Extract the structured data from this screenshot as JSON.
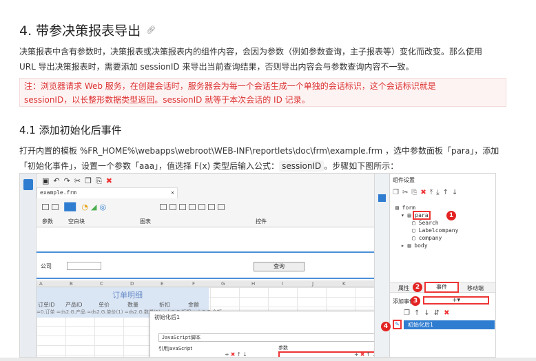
{
  "heading": "4. 带参决策报表导出",
  "heading_anchor_icon": "link-icon",
  "intro_line1": "决策报表中含有参数时，决策报表或决策报表内的组件内容，会因为参数（例如参数查询，主子报表等）变化而改变。那么使用",
  "intro_line2": "URL 导出决策报表时，需要添加 sessionID 来导出当前查询结果，否则导出内容会与参数查询内容不一致。",
  "note_line1": "注：浏览器请求 Web 服务，在创建会话时，服务器会为每一个会话生成一个单独的会话标识，这个会话标识就是",
  "note_line2": "sessionID，以长整形数据类型返回。sessionID 就等于本次会话的 ID 记录。",
  "subheading": "4.1 添加初始化后事件",
  "step": {
    "part1": "打开内置的模板 %FR_HOME%\\webapps\\webroot\\WEB-INF\\reportlets\\doc\\frm\\example.frm ，选中参数面板「para」，添加",
    "part2": "「初始化事件」，设置一个参数「aaa」，值选择 F(x) 类型后输入公式：",
    "code": "sessionID",
    "part3": "。步骤如下图所示："
  },
  "colors": {
    "accent": "#2f7dd1",
    "highlight": "#e33333",
    "note_bg": "#fdf3f3"
  },
  "screenshot": {
    "tab_label": "example.frm",
    "group_labels": [
      "参数",
      "空白块",
      "图表",
      "控件"
    ],
    "param_label": "公司",
    "query_button": "查询",
    "col_letters": [
      "A",
      "B",
      "C",
      "D",
      "E",
      "F",
      "G",
      "H",
      "I",
      "J",
      "K"
    ],
    "report_title": "订单明细",
    "report_headers": [
      "订单ID",
      "产品ID",
      "单价",
      "数量",
      "折扣",
      "金额"
    ],
    "report_row": "=0.订单 =ds2.G.产品 =ds2.G.单价(1) =ds2.G.数量(1) =ds2.G.折扣 =ds2.G.金额",
    "panel_title": "组件设置",
    "tree": [
      "form",
      "para",
      "Search",
      "Labelcompany",
      "company",
      "body"
    ],
    "tabs": [
      "属性",
      "事件",
      "移动端"
    ],
    "add_event_label": "添加事件",
    "event_item": "初始化后1",
    "dialog_title": "初始化后1",
    "dialog_select": "JavaScript脚本",
    "dialog_ref": "引用JavaScript",
    "dialog_params": "参数",
    "badges": [
      "1",
      "2",
      "3",
      "4"
    ]
  }
}
